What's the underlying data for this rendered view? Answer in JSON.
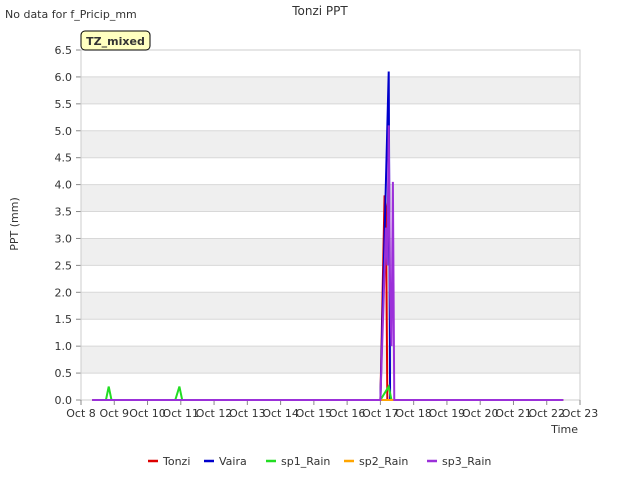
{
  "nodata_note": "No data for f_Pricip_mm",
  "badge": "TZ_mixed",
  "colors": {
    "plot_band": "#efefef",
    "plot_bg": "#ffffff",
    "grid": "#d8d8d8",
    "badge_fill": "#ffffc0",
    "badge_text": "#8b0000"
  },
  "chart_data": {
    "type": "line",
    "title": "Tonzi PPT",
    "xlabel": "Time",
    "ylabel": "PPT (mm)",
    "ylim": [
      0,
      6.5
    ],
    "xlim": [
      "2023-10-08",
      "2023-10-23"
    ],
    "yticks": [
      "0.0",
      "0.5",
      "1.0",
      "1.5",
      "2.0",
      "2.5",
      "3.0",
      "3.5",
      "4.0",
      "4.5",
      "5.0",
      "5.5",
      "6.0",
      "6.5"
    ],
    "xticks": [
      "Oct 8",
      "Oct 9",
      "Oct 10",
      "Oct 11",
      "Oct 12",
      "Oct 13",
      "Oct 14",
      "Oct 15",
      "Oct 16",
      "Oct 17",
      "Oct 18",
      "Oct 19",
      "Oct 20",
      "Oct 21",
      "Oct 22",
      "Oct 23"
    ],
    "grid": true,
    "legend_position": "bottom",
    "series": [
      {
        "name": "Tonzi",
        "color": "#dd0000",
        "points": [
          [
            "2023-10-08 08:00",
            0
          ],
          [
            "2023-10-17 00:00",
            0
          ],
          [
            "2023-10-17 03:00",
            3.8
          ],
          [
            "2023-10-17 04:00",
            3.6
          ],
          [
            "2023-10-17 05:00",
            0
          ],
          [
            "2023-10-22 12:00",
            0
          ]
        ]
      },
      {
        "name": "Vaira",
        "color": "#0000cc",
        "points": [
          [
            "2023-10-08 08:00",
            0
          ],
          [
            "2023-10-17 00:00",
            0
          ],
          [
            "2023-10-17 06:00",
            6.1
          ],
          [
            "2023-10-17 07:00",
            0
          ],
          [
            "2023-10-22 12:00",
            0
          ]
        ]
      },
      {
        "name": "sp1_Rain",
        "color": "#22dd22",
        "points": [
          [
            "2023-10-08 08:00",
            0
          ],
          [
            "2023-10-08 18:00",
            0
          ],
          [
            "2023-10-08 20:00",
            0.25
          ],
          [
            "2023-10-08 22:00",
            0
          ],
          [
            "2023-10-10 20:00",
            0
          ],
          [
            "2023-10-10 23:00",
            0.25
          ],
          [
            "2023-10-11 01:00",
            0
          ],
          [
            "2023-10-17 00:00",
            0
          ],
          [
            "2023-10-17 06:00",
            0.25
          ],
          [
            "2023-10-17 08:00",
            0
          ],
          [
            "2023-10-22 12:00",
            0
          ]
        ]
      },
      {
        "name": "sp2_Rain",
        "color": "#ffa500",
        "points": [
          [
            "2023-10-08 08:00",
            0
          ],
          [
            "2023-10-22 12:00",
            0
          ]
        ]
      },
      {
        "name": "sp3_Rain",
        "color": "#9b30d9",
        "points": [
          [
            "2023-10-08 08:00",
            0
          ],
          [
            "2023-10-17 00:00",
            0
          ],
          [
            "2023-10-17 04:00",
            3.2
          ],
          [
            "2023-10-17 05:00",
            2.5
          ],
          [
            "2023-10-17 06:00",
            5.1
          ],
          [
            "2023-10-17 07:00",
            2.0
          ],
          [
            "2023-10-17 08:00",
            1.0
          ],
          [
            "2023-10-17 09:00",
            4.05
          ],
          [
            "2023-10-17 10:00",
            0
          ],
          [
            "2023-10-22 12:00",
            0
          ]
        ]
      }
    ]
  }
}
